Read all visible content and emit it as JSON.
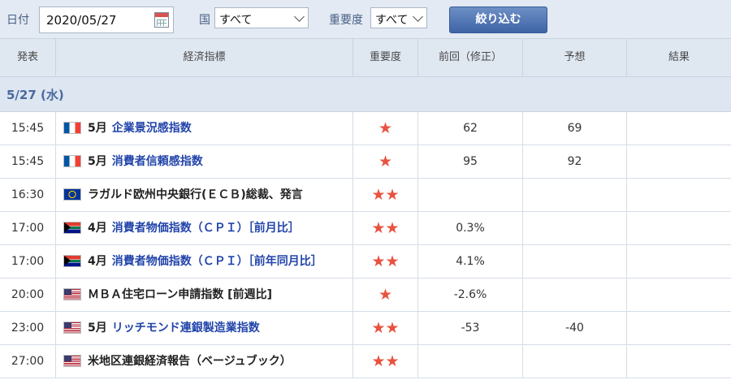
{
  "filter": {
    "date_label": "日付",
    "date_value": "2020/05/27",
    "country_label": "国",
    "country_value": "すべて",
    "importance_label": "重要度",
    "importance_value": "すべて",
    "submit_label": "絞り込む"
  },
  "table": {
    "headers": [
      "発表",
      "経済指標",
      "重要度",
      "前回（修正）",
      "予想",
      "結果"
    ],
    "date_band": "5/27 (水)",
    "rows": [
      {
        "time": "15:45",
        "flag": "france",
        "prefix": "5月",
        "name": "企業景況感指数",
        "link": true,
        "stars": "★",
        "previous": "62",
        "forecast": "69",
        "result": ""
      },
      {
        "time": "15:45",
        "flag": "france",
        "prefix": "5月",
        "name": "消費者信頼感指数",
        "link": true,
        "stars": "★",
        "previous": "95",
        "forecast": "92",
        "result": ""
      },
      {
        "time": "16:30",
        "flag": "eu",
        "prefix": "",
        "name": "ラガルド欧州中央銀行(ＥＣＢ)総裁、発言",
        "link": false,
        "stars": "★★",
        "previous": "",
        "forecast": "",
        "result": ""
      },
      {
        "time": "17:00",
        "flag": "south-africa",
        "prefix": "4月",
        "name": "消費者物価指数（ＣＰＩ）［前月比］",
        "link": true,
        "stars": "★★",
        "previous": "0.3%",
        "forecast": "",
        "result": ""
      },
      {
        "time": "17:00",
        "flag": "south-africa",
        "prefix": "4月",
        "name": "消費者物価指数（ＣＰＩ）［前年同月比］",
        "link": true,
        "stars": "★★",
        "previous": "4.1%",
        "forecast": "",
        "result": ""
      },
      {
        "time": "20:00",
        "flag": "usa",
        "prefix": "",
        "name": "ＭＢＡ住宅ローン申請指数 [前週比]",
        "link": false,
        "stars": "★",
        "previous": "-2.6%",
        "forecast": "",
        "result": ""
      },
      {
        "time": "23:00",
        "flag": "usa",
        "prefix": "5月",
        "name": "リッチモンド連銀製造業指数",
        "link": true,
        "stars": "★★",
        "previous": "-53",
        "forecast": "-40",
        "result": ""
      },
      {
        "time": "27:00",
        "flag": "usa",
        "prefix": "",
        "name": "米地区連銀経済報告（ベージュブック）",
        "link": false,
        "stars": "★★",
        "previous": "",
        "forecast": "",
        "result": ""
      }
    ]
  },
  "colors": {
    "link": "#2244aa",
    "star": "#e8533f",
    "header_bg": "#dfe7f1",
    "button": "#4a6fb0"
  }
}
